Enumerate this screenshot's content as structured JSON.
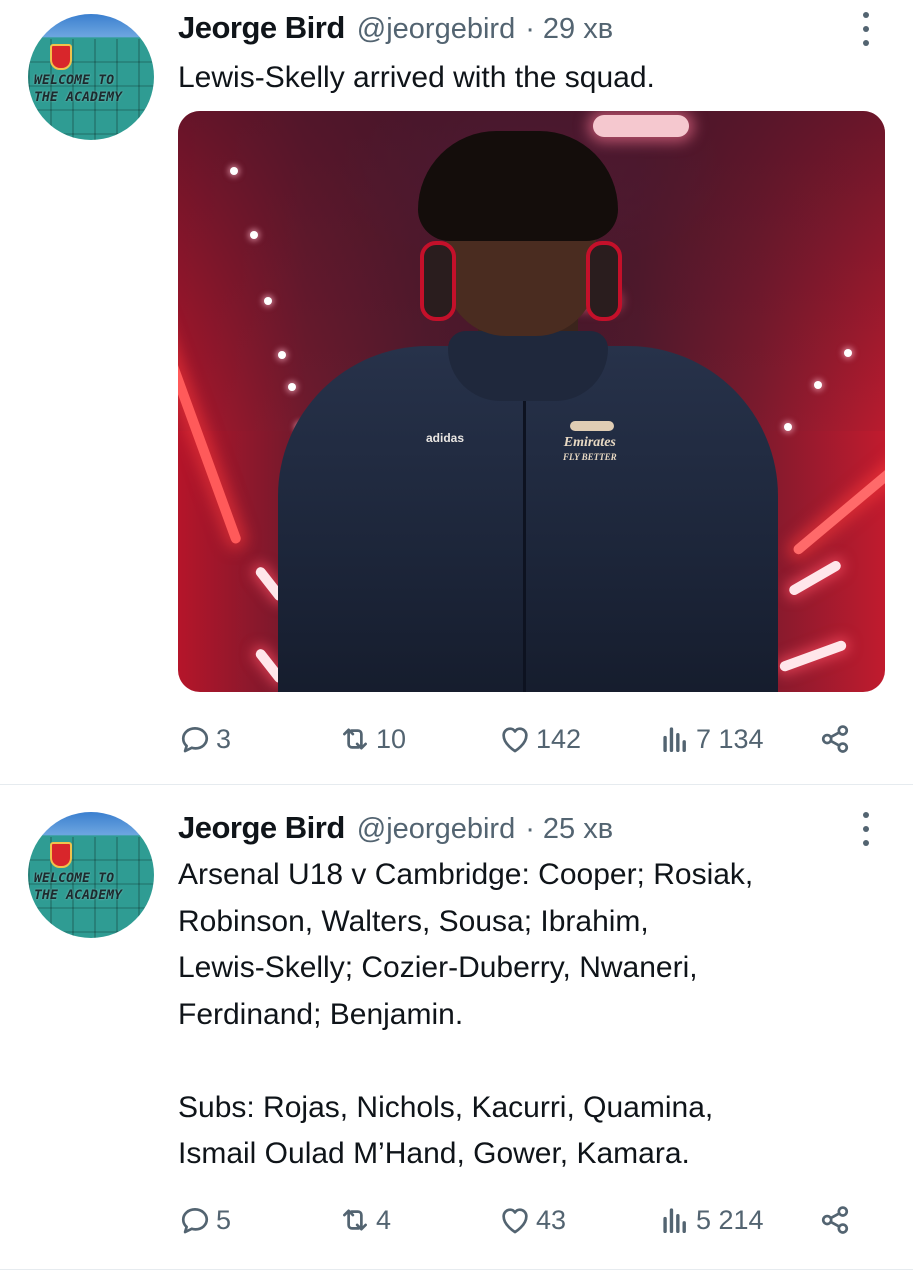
{
  "tweets": [
    {
      "author_name": "Jeorge Bird",
      "handle": "@jeorgebird",
      "time": "· 29 хв",
      "text": "Lewis-Skelly arrived with the squad.",
      "avatar_sign": [
        "WELCOME TO",
        "THE ACADEMY"
      ],
      "media": {
        "brand_logo": "adidas",
        "sponsor_logo": "Emirates",
        "sponsor_sub": "FLY BETTER"
      },
      "actions": {
        "replies": "3",
        "retweets": "10",
        "likes": "142",
        "views": "7 134"
      },
      "icons": [
        "reply-icon",
        "retweet-icon",
        "like-icon",
        "views-icon",
        "share-icon",
        "more-icon"
      ]
    },
    {
      "author_name": "Jeorge Bird",
      "handle": "@jeorgebird",
      "time": "· 25 хв",
      "text_lines": [
        "Arsenal U18 v Cambridge: Cooper; Rosiak,",
        "Robinson, Walters, Sousa; Ibrahim,",
        "Lewis-Skelly; Cozier-Duberry, Nwaneri,",
        "Ferdinand; Benjamin.",
        "",
        "Subs: Rojas, Nichols, Kacurri, Quamina,",
        "Ismail Oulad M’Hand, Gower, Kamara."
      ],
      "avatar_sign": [
        "WELCOME TO",
        "THE ACADEMY"
      ],
      "actions": {
        "replies": "5",
        "retweets": "4",
        "likes": "43",
        "views": "5 214"
      }
    }
  ],
  "colors": {
    "text": "#0f1419",
    "secondary": "#536471",
    "divider": "#e6ebef"
  }
}
